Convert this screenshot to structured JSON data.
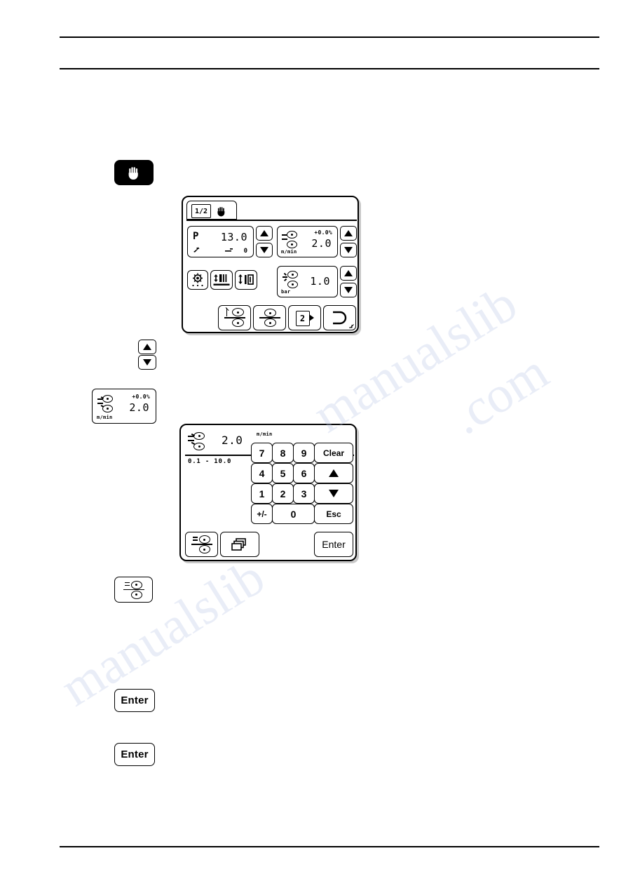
{
  "page": {
    "background": "#ffffff",
    "rules": [
      "top-upper",
      "top-lower",
      "bottom"
    ]
  },
  "watermark": {
    "text_lines": [
      "manualslib",
      ".com",
      "manualslib"
    ],
    "color": "#b9c6e8"
  },
  "steps": {
    "hand_key": {
      "icon": "hand-icon",
      "label": ""
    },
    "updown_key": {
      "up_icon": "triangle-up-icon",
      "down_icon": "triangle-down-icon"
    },
    "speed_display": {
      "icon": "roller-speed-icon",
      "percent": "+0.0%",
      "value": "2.0",
      "unit": "m/min"
    },
    "roller_key": {
      "icon": "roller-adjust-icon"
    },
    "enter_key_1": {
      "label": "Enter"
    },
    "enter_key_2": {
      "label": "Enter"
    }
  },
  "main_screen": {
    "tab_bar": {
      "page_indicator": "1/2",
      "mode_icon": "hand-icon"
    },
    "program_panel": {
      "prefix": "P",
      "value": "13.0",
      "sub_icon_left": "wrench-icon",
      "sub_icon_right": "roller-small-icon",
      "sub_value": "0",
      "up_icon": "triangle-up-icon",
      "down_icon": "triangle-down-icon"
    },
    "speed_panel": {
      "icon": "roller-speed-icon",
      "percent": "+0.0%",
      "value": "2.0",
      "unit": "m/min",
      "up_icon": "triangle-up-icon",
      "down_icon": "triangle-down-icon"
    },
    "pressure_panel": {
      "icon": "roller-pressure-icon",
      "value": "1.0",
      "unit": "bar",
      "up_icon": "triangle-up-icon",
      "down_icon": "triangle-down-icon"
    },
    "function_buttons": [
      {
        "name": "lamp-button",
        "icon": "lamp-icon"
      },
      {
        "name": "height-adjust-button",
        "icon": "height-adjust-icon"
      },
      {
        "name": "gap-adjust-button",
        "icon": "gap-adjust-icon"
      }
    ],
    "toolbar_buttons": [
      {
        "name": "roller-gap-button",
        "icon": "roller-gap-icon"
      },
      {
        "name": "roller-pair-button",
        "icon": "roller-pair-icon"
      },
      {
        "name": "page-2-button",
        "icon": "page-2-icon",
        "label": "2"
      },
      {
        "name": "return-button",
        "icon": "return-icon"
      }
    ]
  },
  "keypad_screen": {
    "value_header": {
      "icon": "roller-speed-icon",
      "value": "2.0",
      "unit": "m/min",
      "range": "0.1 - 10.0"
    },
    "keys": [
      {
        "label": "7",
        "name": "key-7"
      },
      {
        "label": "8",
        "name": "key-8"
      },
      {
        "label": "9",
        "name": "key-9"
      },
      {
        "label": "Clear",
        "name": "key-clear"
      },
      {
        "label": "4",
        "name": "key-4"
      },
      {
        "label": "5",
        "name": "key-5"
      },
      {
        "label": "6",
        "name": "key-6"
      },
      {
        "label": "",
        "name": "key-up",
        "icon": "triangle-up-icon"
      },
      {
        "label": "1",
        "name": "key-1"
      },
      {
        "label": "2",
        "name": "key-2"
      },
      {
        "label": "3",
        "name": "key-3"
      },
      {
        "label": "",
        "name": "key-down",
        "icon": "triangle-down-icon"
      },
      {
        "label": "+/-",
        "name": "key-plusminus"
      },
      {
        "label": "0",
        "name": "key-0"
      },
      {
        "label": "Esc",
        "name": "key-esc"
      }
    ],
    "bottom_bar": {
      "roller_button_icon": "roller-adjust-icon",
      "copy_button_icon": "copy-pages-icon",
      "enter_label": "Enter"
    }
  }
}
